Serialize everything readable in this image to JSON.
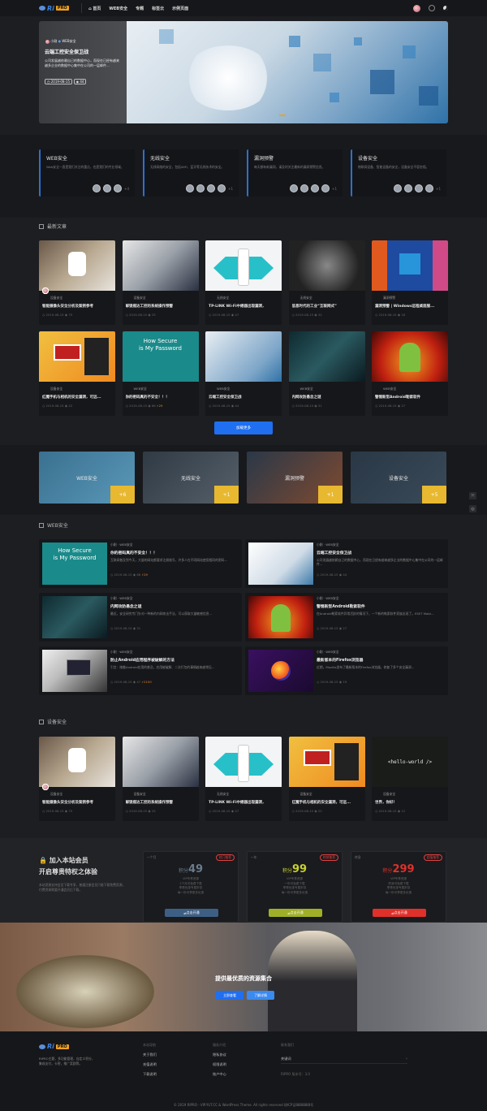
{
  "header": {
    "logo_ri": "Ri",
    "logo_pro": "PRO",
    "nav": [
      "首页",
      "WEB安全",
      "专题",
      "标签云",
      "示例页面"
    ]
  },
  "banner": {
    "author": "小刚",
    "category": "WEB安全",
    "title": "云端工控安全保卫战",
    "excerpt": "公司发展越依赖自己的数据中心，而现在已经有越来越多企业的数据中心集中在公司的一层邮件...",
    "date": "2019-08-15",
    "views": "44"
  },
  "categories": [
    {
      "title": "WEB安全",
      "desc": "Web安全一直是我们关注的重点，也是我们的专业领域。",
      "more": "+4"
    },
    {
      "title": "无线安全",
      "desc": "无线网络的安全，包括WiFi、蓝牙等无线技术的安全。",
      "more": "+1"
    },
    {
      "title": "漏洞预警",
      "desc": "每天都有新漏洞，请及时关注最新的漏洞预警信息。",
      "more": "+1"
    },
    {
      "title": "设备安全",
      "desc": "物联网设备、智能设备的安全，设备安全不容忽视。",
      "more": "+1"
    }
  ],
  "latest": {
    "title": "最新文章",
    "posts": [
      {
        "cat": "设备安全",
        "title": "智能摄像头安全分析及案例参考",
        "date": "2019-08-15",
        "views": "75"
      },
      {
        "cat": "设备安全",
        "title": "解锁摇达工控的系统操作预警",
        "date": "2019-08-15",
        "views": "25"
      },
      {
        "cat": "无线安全",
        "title": "TP-LINK Wi-Fi中继器出现漏洞，",
        "date": "2019-08-15",
        "views": "47"
      },
      {
        "cat": "无线安全",
        "title": "信息时代的工业“互联网式”",
        "date": "2019-08-15",
        "views": "32"
      },
      {
        "cat": "漏洞预警",
        "title": "漏洞预警 | Windows远程桌面服...",
        "date": "2019-08-15",
        "views": "18"
      },
      {
        "cat": "设备安全",
        "title": "红魔手机与相机的安全漏洞，可远...",
        "date": "2019-08-15",
        "views": "22"
      },
      {
        "cat": "WEB安全",
        "title": "你的密码真的不安全！！！",
        "date": "2019-08-15",
        "views": "68",
        "pts": "29"
      },
      {
        "cat": "WEB安全",
        "title": "云端工控安全保卫战",
        "date": "2019-08-15",
        "views": "44"
      },
      {
        "cat": "WEB安全",
        "title": "内网攻防悬念之谜",
        "date": "2019-08-15",
        "views": "31"
      },
      {
        "cat": "WEB安全",
        "title": "警惕新型Android勒索软件",
        "date": "2019-08-15",
        "views": "27"
      }
    ],
    "load_more": "加载更多"
  },
  "cat_banners": [
    {
      "label": "WEB安全",
      "count": "+6"
    },
    {
      "label": "无线安全",
      "count": "+1"
    },
    {
      "label": "漏洞预警",
      "count": "+1"
    },
    {
      "label": "设备安全",
      "count": "+5"
    }
  ],
  "web": {
    "title": "WEB安全",
    "items": [
      {
        "author": "小刚",
        "cat": "WEB安全",
        "title": "你的密码真的不安全！！！",
        "excerpt": "互联网普及到今天，大量的网站都要求注册账号，许多人在不同网站使用相同的密码...",
        "date": "2019-08-15",
        "views": "68",
        "pts": "29"
      },
      {
        "author": "小刚",
        "cat": "WEB安全",
        "title": "云端工控安全保卫战",
        "excerpt": "公司发展越依赖自己的数据中心，而现在已经有越来越多企业的数据中心集中在公司的一层邮件...",
        "date": "2019-08-15",
        "views": "44"
      },
      {
        "author": "小刚",
        "cat": "WEB安全",
        "title": "内网攻防悬念之谜",
        "excerpt": "最近，安全研究专门针对一种新的内网攻击手法，可以获取大量敏感信息...",
        "date": "2019-08-15",
        "views": "31"
      },
      {
        "author": "小刚",
        "cat": "WEB安全",
        "title": "警惕新型Android勒索软件",
        "excerpt": "在Android勒索软件异常活跃的情况下，一个新的勒索软件家族出现了。ESET Mobi...",
        "date": "2019-08-15",
        "views": "27"
      },
      {
        "author": "小刚",
        "cat": "WEB安全",
        "title": "防止Android应用程序被破解的方法",
        "excerpt": "引言：随着Android应用的普及，应用被破解、二次打包的事情越来越常见...",
        "date": "2019-08-15",
        "views": "47",
        "pts": "2100"
      },
      {
        "author": "小刚",
        "cat": "WEB安全",
        "title": "最新版本的Firefox浏览器",
        "excerpt": "近期，Mozilla发布了最新版本的Firefox浏览器，修复了多个安全漏洞...",
        "date": "2019-08-15",
        "views": "19"
      }
    ]
  },
  "device": {
    "title": "设备安全",
    "posts": [
      {
        "cat": "设备安全",
        "title": "智能摄像头安全分析及案例参考",
        "date": "2019-08-15",
        "views": "75"
      },
      {
        "cat": "设备安全",
        "title": "解锁摇达工控的系统操作预警",
        "date": "2019-08-15",
        "views": "25"
      },
      {
        "cat": "无线安全",
        "title": "TP-LINK Wi-Fi中继器出现漏洞，",
        "date": "2019-08-15",
        "views": "47"
      },
      {
        "cat": "设备安全",
        "title": "红魔手机与相机的安全漏洞，可远...",
        "date": "2019-08-15",
        "views": "22"
      },
      {
        "cat": "设备安全",
        "title": "世界，你好！",
        "date": "2019-08-15",
        "views": "12"
      }
    ]
  },
  "vip": {
    "title": "加入本站会员",
    "subtitle": "开启尊贵特权之体验",
    "desc": "本站资源支持会员下载专享，普通注册会员只能下载免费资源，付费资源需要开通会员后下载。",
    "plans": [
      {
        "period": "一个月",
        "tag": "热门推荐",
        "label": "积分",
        "price": "49",
        "features": [
          "VIP专享资源",
          "1个月可免费下载",
          "享受优惠专属折扣",
          "每一份可享更多优惠"
        ],
        "btn": "点击开通",
        "color": "#3e5f84"
      },
      {
        "period": "一年",
        "tag": "热销推荐",
        "label": "积分",
        "price": "99",
        "features": [
          "VIP专享资源",
          "一年可免费下载",
          "享受优惠专属折扣",
          "每一份可享更多优惠"
        ],
        "btn": "点击开通",
        "color": "#9fb028"
      },
      {
        "period": "终身",
        "tag": "超值推荐",
        "label": "积分",
        "price": "299",
        "features": [
          "VIP专享资源",
          "终身可免费下载",
          "享受优惠专属折扣",
          "每一份可享更多优惠"
        ],
        "btn": "点击开通",
        "color": "#e0302a"
      }
    ]
  },
  "hero": {
    "text": "提供最优质的资源集合",
    "btn1": "立即查看",
    "btn2": "了解详情"
  },
  "footer": {
    "logo_ri": "Ri",
    "logo_pro": "PRO",
    "about": "RIPRO主题，多功能管理，自定义积分，集成支付，卡密，推广奖励等。",
    "col1_title": "本站导航",
    "col1": [
      "关于我们",
      "充值说明",
      "下载说明"
    ],
    "col2_title": "服务介绍",
    "col2": [
      "隐私协议",
      "权限说明",
      "账户中心"
    ],
    "col3_title": "联系我们",
    "col3": [
      "关键词"
    ],
    "version": "RIPRO 版本号：3.0",
    "copyright": "© 2019 RIPRO - VIP.YUT.CC & WordPress Theme. All rights reserved 琼ICP证8888888号"
  }
}
